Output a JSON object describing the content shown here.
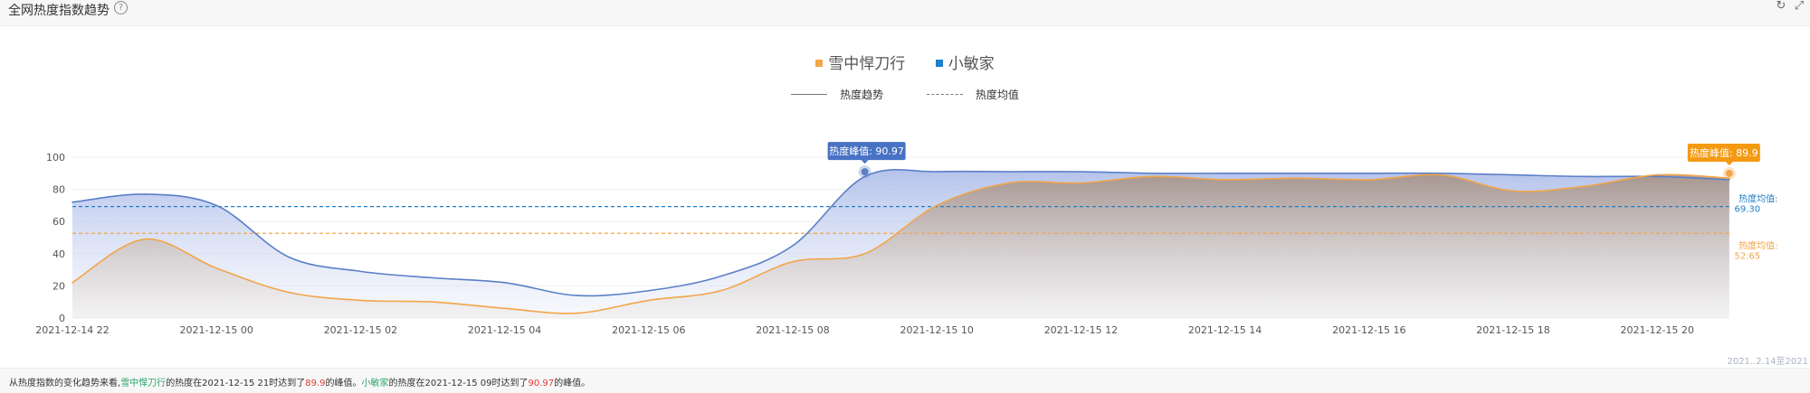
{
  "header": {
    "title": "全网热度指数趋势",
    "help_icon": "question-circle-icon",
    "refresh_icon": "refresh-icon",
    "expand_icon": "expand-icon"
  },
  "legend": {
    "series": [
      {
        "name": "雪中悍刀行",
        "color": "#f2a54a"
      },
      {
        "name": "小敏家",
        "color": "#1f7fc8"
      }
    ],
    "line_types": [
      {
        "label": "热度趋势",
        "style": "solid"
      },
      {
        "label": "热度均值",
        "style": "dashed"
      }
    ]
  },
  "chart_data": {
    "type": "area",
    "x_tick_labels": [
      "2021-12-14 22",
      "2021-12-15 00",
      "2021-12-15 02",
      "2021-12-15 04",
      "2021-12-15 06",
      "2021-12-15 08",
      "2021-12-15 10",
      "2021-12-15 12",
      "2021-12-15 14",
      "2021-12-15 16",
      "2021-12-15 18",
      "2021-12-15 20"
    ],
    "ylim": [
      0,
      100
    ],
    "y_ticks": [
      0,
      20,
      40,
      60,
      80,
      100
    ],
    "grid": true,
    "series": [
      {
        "name": "小敏家",
        "color": "#5b7fc8",
        "x_hours": [
          0,
          1,
          2,
          3,
          4,
          5,
          6,
          7,
          8,
          9,
          10,
          11,
          12,
          13,
          14,
          15,
          16,
          17,
          18,
          19,
          20,
          21,
          22,
          23
        ],
        "values": [
          72,
          77,
          70,
          38,
          29,
          25,
          22,
          14,
          17,
          26,
          45,
          88,
          91,
          91,
          91,
          90,
          90,
          90,
          90,
          90,
          89,
          88,
          88,
          86
        ],
        "average": 69.3,
        "peak": {
          "x_hour": 11,
          "value": 90.97,
          "label": "热度峰值: 90.97"
        },
        "average_label": "热度均值:\n69.30"
      },
      {
        "name": "雪中悍刀行",
        "color": "#f2a54a",
        "x_hours": [
          0,
          1,
          2,
          3,
          4,
          5,
          6,
          7,
          8,
          9,
          10,
          11,
          12,
          13,
          14,
          15,
          16,
          17,
          18,
          19,
          20,
          21,
          22,
          23
        ],
        "values": [
          22,
          49,
          31,
          16,
          11,
          10,
          6,
          3,
          11,
          17,
          35,
          40,
          70,
          84,
          84,
          88,
          86,
          87,
          86,
          89,
          79,
          82,
          89,
          87
        ],
        "average": 52.65,
        "peak": {
          "x_hour": 23,
          "value": 89.9,
          "label": "热度峰值: 89.9"
        },
        "average_label": "热度均值:\n52.65"
      }
    ]
  },
  "footer": {
    "prefix": "从热度指数的变化趋势来看,",
    "name1": "雪中悍刀行",
    "mid1": "的热度在2021-12-15 21时达到了",
    "val1": "89.9",
    "mid2": "的峰值。",
    "name2": "小敏家",
    "mid3": "的热度在2021-12-15 09时达到了",
    "val2": "90.97",
    "suffix": "的峰值。"
  },
  "range_note": "2021..2.14至2021"
}
